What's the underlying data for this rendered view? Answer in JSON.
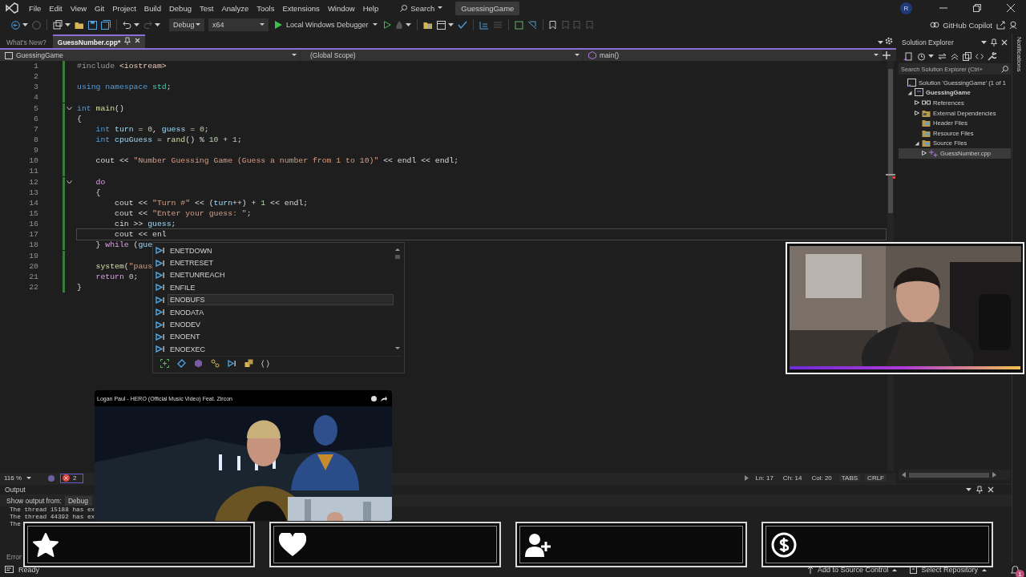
{
  "menu_bar": {
    "items": [
      "File",
      "Edit",
      "View",
      "Git",
      "Project",
      "Build",
      "Debug",
      "Test",
      "Analyze",
      "Tools",
      "Extensions",
      "Window",
      "Help"
    ],
    "search": "Search",
    "solution_name": "GuessingGame",
    "account_initial": "R"
  },
  "toolbar": {
    "configuration": "Debug",
    "platform": "x64",
    "debugger": "Local Windows Debugger",
    "copilot": "GitHub Copilot"
  },
  "document_tabs": [
    {
      "label": "What's New?",
      "selected": false
    },
    {
      "label": "GuessNumber.cpp*",
      "selected": true
    }
  ],
  "navigation_bar": {
    "project": "GuessingGame",
    "scope": "(Global Scope)",
    "member": "main()"
  },
  "editor": {
    "lines": [
      {
        "number": "1",
        "current": false,
        "foldable": false,
        "tokens": [
          {
            "text": "#include",
            "kind": "directive"
          },
          {
            "text": " <iostream>",
            "kind": "header"
          }
        ]
      },
      {
        "number": "2",
        "current": false,
        "foldable": false
      },
      {
        "number": "3",
        "current": false,
        "foldable": false,
        "tokens": [
          {
            "text": "using namespace",
            "kind": "keyword"
          },
          {
            "text": " std",
            "kind": "namespace"
          },
          {
            "text": ";",
            "kind": "plain"
          }
        ]
      },
      {
        "number": "4",
        "current": false,
        "foldable": false
      },
      {
        "number": "5",
        "current": false,
        "foldable": true,
        "tokens": [
          {
            "text": "int",
            "kind": "keyword"
          },
          {
            "text": " main",
            "kind": "function"
          },
          {
            "text": "()",
            "kind": "plain"
          }
        ]
      },
      {
        "number": "6",
        "current": false,
        "foldable": false,
        "tokens": [
          {
            "text": "{",
            "kind": "plain"
          }
        ]
      },
      {
        "number": "7",
        "current": false,
        "foldable": false,
        "tokens": [
          {
            "text": "    int",
            "kind": "keyword"
          },
          {
            "text": " turn",
            "kind": "variable"
          },
          {
            "text": " = ",
            "kind": "plain"
          },
          {
            "text": "0",
            "kind": "number"
          },
          {
            "text": ", ",
            "kind": "plain"
          },
          {
            "text": "guess",
            "kind": "variable"
          },
          {
            "text": " = ",
            "kind": "plain"
          },
          {
            "text": "0",
            "kind": "number"
          },
          {
            "text": ";",
            "kind": "plain"
          }
        ]
      },
      {
        "number": "8",
        "current": false,
        "foldable": false,
        "tokens": [
          {
            "text": "    int",
            "kind": "keyword"
          },
          {
            "text": " cpuGuess",
            "kind": "variable"
          },
          {
            "text": " = ",
            "kind": "plain"
          },
          {
            "text": "rand",
            "kind": "function"
          },
          {
            "text": "() % ",
            "kind": "plain"
          },
          {
            "text": "10",
            "kind": "number"
          },
          {
            "text": " + ",
            "kind": "plain"
          },
          {
            "text": "1",
            "kind": "number"
          },
          {
            "text": ";",
            "kind": "plain"
          }
        ]
      },
      {
        "number": "9",
        "current": false,
        "foldable": false
      },
      {
        "number": "10",
        "current": false,
        "foldable": false,
        "tokens": [
          {
            "text": "    cout << ",
            "kind": "plain"
          },
          {
            "text": "\"Number Guessing Game (Guess a number from 1 to 10)\"",
            "kind": "string"
          },
          {
            "text": " << endl << endl;",
            "kind": "plain"
          }
        ]
      },
      {
        "number": "11",
        "current": false,
        "foldable": false
      },
      {
        "number": "12",
        "current": false,
        "foldable": true,
        "tokens": [
          {
            "text": "    do",
            "kind": "control"
          }
        ]
      },
      {
        "number": "13",
        "current": false,
        "foldable": false,
        "tokens": [
          {
            "text": "    {",
            "kind": "plain"
          }
        ]
      },
      {
        "number": "14",
        "current": false,
        "foldable": false,
        "tokens": [
          {
            "text": "        cout << ",
            "kind": "plain"
          },
          {
            "text": "\"Turn #\"",
            "kind": "string"
          },
          {
            "text": " << (",
            "kind": "plain"
          },
          {
            "text": "turn",
            "kind": "variable"
          },
          {
            "text": "++) + ",
            "kind": "plain"
          },
          {
            "text": "1",
            "kind": "number"
          },
          {
            "text": " << endl;",
            "kind": "plain"
          }
        ]
      },
      {
        "number": "15",
        "current": false,
        "foldable": false,
        "tokens": [
          {
            "text": "        cout << ",
            "kind": "plain"
          },
          {
            "text": "\"Enter your guess: \"",
            "kind": "string"
          },
          {
            "text": ";",
            "kind": "plain"
          }
        ]
      },
      {
        "number": "16",
        "current": false,
        "foldable": false,
        "tokens": [
          {
            "text": "        cin >> ",
            "kind": "plain"
          },
          {
            "text": "guess",
            "kind": "variable"
          },
          {
            "text": ";",
            "kind": "plain"
          }
        ]
      },
      {
        "number": "17",
        "current": true,
        "foldable": false,
        "tokens": [
          {
            "text": "        cout << enl",
            "kind": "plain"
          }
        ]
      },
      {
        "number": "18",
        "current": false,
        "foldable": false,
        "tokens": [
          {
            "text": "    } ",
            "kind": "plain"
          },
          {
            "text": "while",
            "kind": "control"
          },
          {
            "text": " (",
            "kind": "plain"
          },
          {
            "text": "gue",
            "kind": "variable"
          }
        ]
      },
      {
        "number": "19",
        "current": false,
        "foldable": false
      },
      {
        "number": "20",
        "current": false,
        "foldable": false,
        "tokens": [
          {
            "text": "    system",
            "kind": "function"
          },
          {
            "text": "(",
            "kind": "plain"
          },
          {
            "text": "\"paus",
            "kind": "string"
          }
        ]
      },
      {
        "number": "21",
        "current": false,
        "foldable": false,
        "tokens": [
          {
            "text": "    return",
            "kind": "control"
          },
          {
            "text": " 0",
            "kind": "number"
          },
          {
            "text": ";",
            "kind": "plain"
          }
        ]
      },
      {
        "number": "22",
        "current": false,
        "foldable": false,
        "tokens": [
          {
            "text": "}",
            "kind": "plain"
          }
        ]
      }
    ]
  },
  "completion_list": {
    "items": [
      {
        "label": "ENETDOWN",
        "selected": false
      },
      {
        "label": "ENETRESET",
        "selected": false
      },
      {
        "label": "ENETUNREACH",
        "selected": false
      },
      {
        "label": "ENFILE",
        "selected": false
      },
      {
        "label": "ENOBUFS",
        "selected": true
      },
      {
        "label": "ENODATA",
        "selected": false
      },
      {
        "label": "ENODEV",
        "selected": false
      },
      {
        "label": "ENOENT",
        "selected": false
      },
      {
        "label": "ENOEXEC",
        "selected": false
      }
    ]
  },
  "editor_status": {
    "zoom": "116 %",
    "errors": "2",
    "line": "Ln: 17",
    "char": "Ch: 14",
    "column": "Col: 20",
    "indent": "TABS",
    "line_ending": "CRLF"
  },
  "solution_explorer": {
    "title": "Solution Explorer",
    "search_placeholder": "Search Solution Explorer (Ctrl+",
    "tree": [
      {
        "label": "Solution 'GuessingGame' (1 of 1",
        "kind": "solution",
        "selected": false,
        "children": [
          {
            "label": "GuessingGame",
            "kind": "project",
            "expanded": true,
            "selected": false,
            "children": [
              {
                "label": "References",
                "kind": "references",
                "expanded": false,
                "selected": false
              },
              {
                "label": "External Dependencies",
                "kind": "dependencies",
                "expanded": false,
                "selected": false
              },
              {
                "label": "Header Files",
                "kind": "filter",
                "selected": false
              },
              {
                "label": "Resource Files",
                "kind": "filter",
                "selected": false
              },
              {
                "label": "Source Files",
                "kind": "filter",
                "expanded": true,
                "selected": false,
                "children": [
                  {
                    "label": "GuessNumber.cpp",
                    "kind": "file",
                    "expanded": false,
                    "selected": true
                  }
                ]
              }
            ]
          }
        ]
      }
    ]
  },
  "notifications_tab": "Notifications",
  "output_panel": {
    "title": "Output",
    "source_label": "Show output from:",
    "source": "Debug",
    "lines": [
      "The thread 15188 has ex",
      "The thread 44392 has ex",
      "The"
    ],
    "tab": "Error"
  },
  "status_bar": {
    "status": "Ready",
    "source_control": "Add to Source Control",
    "repository": "Select Repository",
    "notification_count": "1"
  },
  "video_player": {
    "title": "Logan Paul - HERO (Official Music Video) Feat. Zircon"
  },
  "alert_boxes": [
    {
      "kind": "star"
    },
    {
      "kind": "heart"
    },
    {
      "kind": "follower"
    },
    {
      "kind": "dollar"
    }
  ]
}
